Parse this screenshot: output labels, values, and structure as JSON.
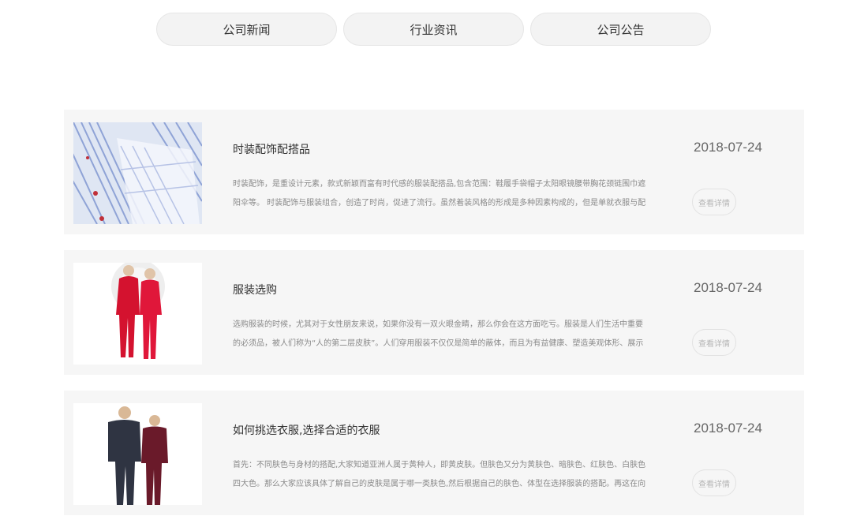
{
  "tabs": [
    {
      "label": "公司新闻"
    },
    {
      "label": "行业资讯"
    },
    {
      "label": "公司公告"
    }
  ],
  "news": [
    {
      "title": "时装配饰配搭品",
      "summary": "时装配饰，是重设计元素，款式新颖而富有时代感的服装配搭品,包含范围：鞋履手袋帽子太阳眼镜腰带胸花颈链围巾遮阳伞等。    时装配饰与服装组合，创造了时尚，促进了流行。虽然着装风格的形成是多种因素构成的，但是单就衣服与配件",
      "date": "2018-07-24",
      "more_label": "查看详情",
      "image": "striped-dress-photo"
    },
    {
      "title": "服装选购",
      "summary": "选购服装的时候，尤其对于女性朋友来说，如果你没有一双火眼金睛，那么你会在这方面吃亏。服装是人们生活中重要的必须品，被人们称为“人的第二层皮肤”。人们穿用服装不仅仅是简单的蔽体，而且为有益健康、塑造美观体形、展示整体魅",
      "date": "2018-07-24",
      "more_label": "查看详情",
      "image": "red-thermal-couple-photo"
    },
    {
      "title": "如何挑选衣服,选择合适的衣服",
      "summary": "首先：不同肤色与身材的搭配,大家知道亚洲人属于黄种人，即黄皮肤。但肤色又分为黄肤色、暗肤色、红肤色、白肤色四大色。那么大家应该具体了解自己的皮肤是属于哪一类肤色,然后根据自己的肤色、体型在选择服装的搭配。再这在向大家",
      "date": "2018-07-24",
      "more_label": "查看详情",
      "image": "dark-thermal-couple-photo"
    }
  ]
}
